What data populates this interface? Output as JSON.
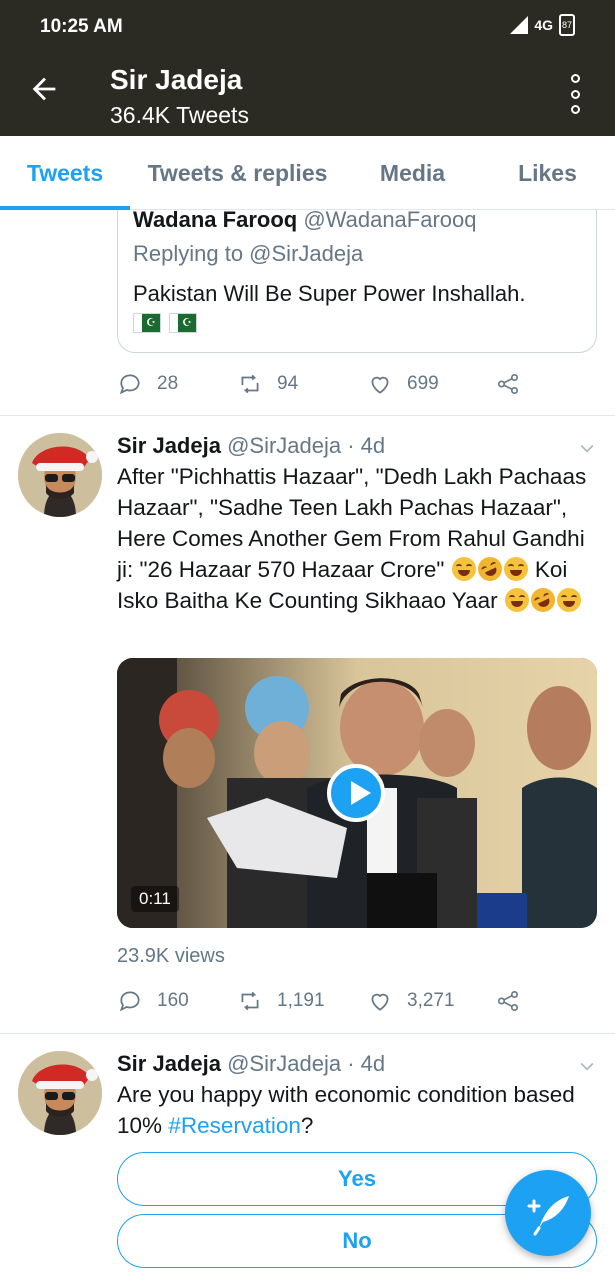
{
  "status_bar": {
    "time": "10:25 AM",
    "network": "4G",
    "battery": "87"
  },
  "header": {
    "title": "Sir Jadeja",
    "subtitle": "36.4K Tweets"
  },
  "tabs": [
    {
      "label": "Tweets",
      "active": true
    },
    {
      "label": "Tweets & replies",
      "active": false
    },
    {
      "label": "Media",
      "active": false
    },
    {
      "label": "Likes",
      "active": false
    }
  ],
  "quoted_tweet": {
    "name": "Wadana Farooq",
    "handle": "@WadanaFarooq",
    "reply_to": "Replying to @SirJadeja",
    "text": "Pakistan Will Be Super Power Inshallah.",
    "stats": {
      "replies": "28",
      "retweets": "94",
      "likes": "699"
    }
  },
  "tweets": [
    {
      "name": "Sir Jadeja",
      "handle_time": "@SirJadeja · 4d",
      "text_part1": "After \"Pichhattis Hazaar\", \"Dedh Lakh Pachaas Hazaar\", \"Sadhe Teen Lakh Pachas Hazaar\", Here Comes Another Gem From Rahul Gandhi ji: \"26 Hazaar 570 Hazaar Crore\"",
      "text_part2": "Koi Isko Baitha Ke Counting Sikhaao Yaar",
      "video_duration": "0:11",
      "views": "23.9K views",
      "stats": {
        "replies": "160",
        "retweets": "1,191",
        "likes": "3,271"
      }
    },
    {
      "name": "Sir Jadeja",
      "handle_time": "@SirJadeja · 4d",
      "text": "Are you happy with economic condition based 10%",
      "hashtag": "#Reservation",
      "text_end": "?",
      "poll_options": [
        "Yes",
        "No"
      ]
    }
  ],
  "colors": {
    "accent": "#1da1f2",
    "header_bg": "#2b2a23",
    "muted": "#657786"
  },
  "icons": [
    "back-arrow-icon",
    "more-vertical-icon",
    "reply-icon",
    "retweet-icon",
    "like-icon",
    "share-icon",
    "chevron-down-icon",
    "play-icon",
    "compose-icon"
  ]
}
